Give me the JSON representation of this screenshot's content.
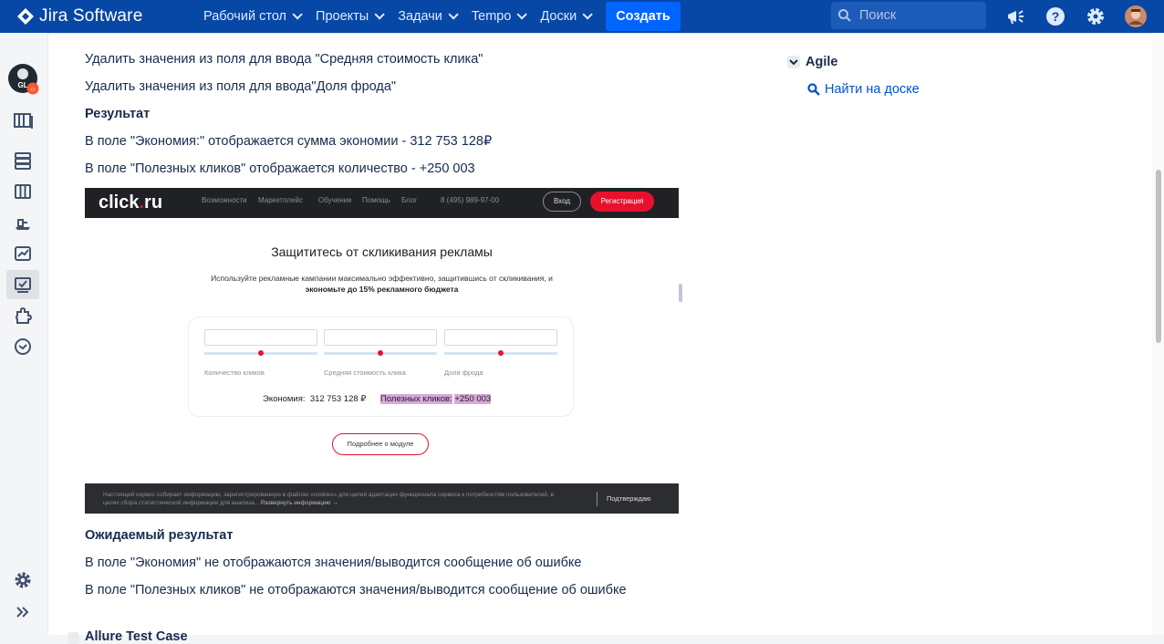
{
  "topbar": {
    "app_name": "Jira Software",
    "nav": [
      {
        "label": "Рабочий стол"
      },
      {
        "label": "Проекты"
      },
      {
        "label": "Задачи"
      },
      {
        "label": "Tempo"
      },
      {
        "label": "Доски"
      }
    ],
    "create_label": "Создать",
    "search_placeholder": "Поиск",
    "icons": [
      "megaphone-icon",
      "help-icon",
      "settings-icon",
      "avatar"
    ]
  },
  "content": {
    "lines": [
      "Удалить значения из поля для ввода \"Средняя стоимость клика\"",
      "Удалить значения из поля для ввода\"Доля фрода\"",
      "Результат",
      "В поле \"Экономия:\" отображается сумма экономии - 312 753 128₽",
      "В поле \"Полезных кликов\" отображается количество - +250 003"
    ],
    "expected_title": "Ожидаемый результат",
    "expected_lines": [
      "В поле \"Экономия\" не отображаются значения/выводится сообщение об ошибке",
      "В поле \"Полезных кликов\" не отображаются значения/выводится сообщение об ошибке"
    ],
    "cut_off_title": "Allure Test Case"
  },
  "screenshot": {
    "logo_main": "click",
    "logo_dot": ".",
    "logo_tld": "ru",
    "menu": [
      "Возможности",
      "Маркетплейс",
      "Обучение",
      "Помощь",
      "Блог",
      "8 (495) 989-97-00"
    ],
    "login": "Вход",
    "register": "Регистрация",
    "title": "Защититесь от скликивания рекламы",
    "subtitle": "Используйте рекламные кампании максимально эффективно, защитившись от скликивания, и",
    "subtitle_bold": "экономьте до 15% рекламного бюджета",
    "field_labels": [
      "Количество кликов",
      "Средняя стоимость клика",
      "Доля фрода"
    ],
    "economy_label": "Экономия:",
    "economy_value": "312 753 128 ₽",
    "useful_label": "Полезных кликов:",
    "useful_value": "+250 003",
    "more_button": "Подробнее о модуле",
    "cookie_text": "Настоящий сервис собирает информацию, зарегистрированную в файлах «cookies» для целей адаптации функционала сервиса к потребностям пользователей, в целях сбора статистической информации для анализа...",
    "cookie_more": "Развернуть информацию →",
    "cookie_confirm": "Подтверждаю"
  },
  "agile": {
    "title": "Agile",
    "link": "Найти на доске"
  },
  "colors": {
    "topbar": "#0747a6",
    "create": "#0065ff",
    "link": "#0052cc",
    "brand_red": "#e8112d"
  }
}
